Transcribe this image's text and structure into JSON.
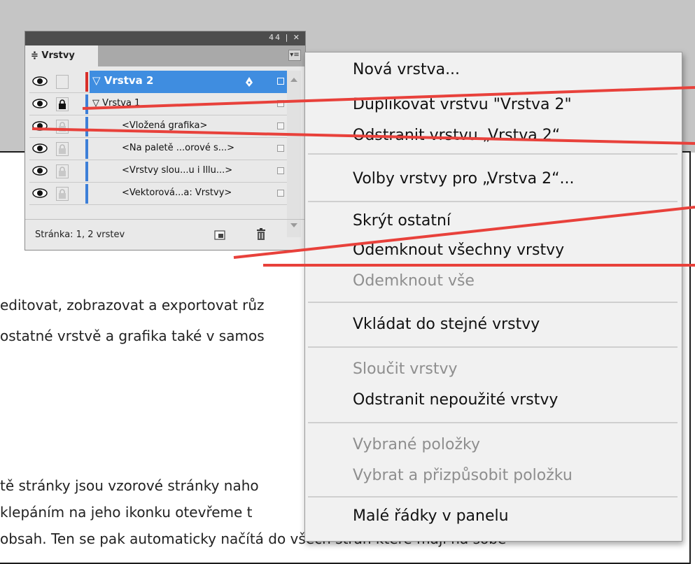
{
  "panel": {
    "titlebar_buttons": "44 | ✕",
    "tab_label": "≑ Vrstvy",
    "menu_button_glyph": "▾≡",
    "layers": [
      {
        "name": "Vrstva 2",
        "selected": true,
        "color": "#d8302a"
      },
      {
        "name": "Vrstva 1",
        "selected": false,
        "color": "#3d7fd8"
      },
      {
        "name": "<Vložená grafika>",
        "selected": false,
        "color": "#3d7fd8"
      },
      {
        "name": "<Na paletě ...orové s...>",
        "selected": false,
        "color": "#3d7fd8"
      },
      {
        "name": "<Vrstvy slou...u i Illu...>",
        "selected": false,
        "color": "#3d7fd8"
      },
      {
        "name": "<Vektorová...a: Vrstvy>",
        "selected": false,
        "color": "#3d7fd8"
      }
    ],
    "status": "Stránka: 1, 2 vrstev"
  },
  "menu": {
    "items": [
      {
        "label": "Nová vrstva...",
        "enabled": true
      },
      {
        "label": "Duplikovat vrstvu \"Vrstva 2\"",
        "enabled": true
      },
      {
        "label": "Odstranit vrstvu „Vrstva 2“",
        "enabled": true
      },
      {
        "label": "Volby vrstvy pro „Vrstva 2“...",
        "enabled": true
      },
      {
        "label": "Skrýt ostatní",
        "enabled": true
      },
      {
        "label": "Odemknout všechny vrstvy",
        "enabled": true
      },
      {
        "label": "Odemknout vše",
        "enabled": false
      },
      {
        "label": "Vkládat do stejné vrstvy",
        "enabled": true
      },
      {
        "label": "Sloučit vrstvy",
        "enabled": false
      },
      {
        "label": "Odstranit nepoužité vrstvy",
        "enabled": true
      },
      {
        "label": "Vybrané položky",
        "enabled": false
      },
      {
        "label": "Vybrat a přizpůsobit položku",
        "enabled": false
      },
      {
        "label": "Malé řádky v panelu",
        "enabled": true
      }
    ]
  },
  "document": {
    "lines": [
      "editovat, zobrazovat a exportovat růz",
      "ostatné vrstvě a grafika také v samos",
      "tě stránky jsou vzorové stránky naho",
      "klepáním na jeho ikonku otevřeme t",
      "obsah. Ten se pak automaticky načítá do všech stran které mají na sobě"
    ]
  },
  "colors": {
    "selection": "#3f8de0",
    "annotation": "#e8413b",
    "disabled_text": "#8e8e8e"
  }
}
